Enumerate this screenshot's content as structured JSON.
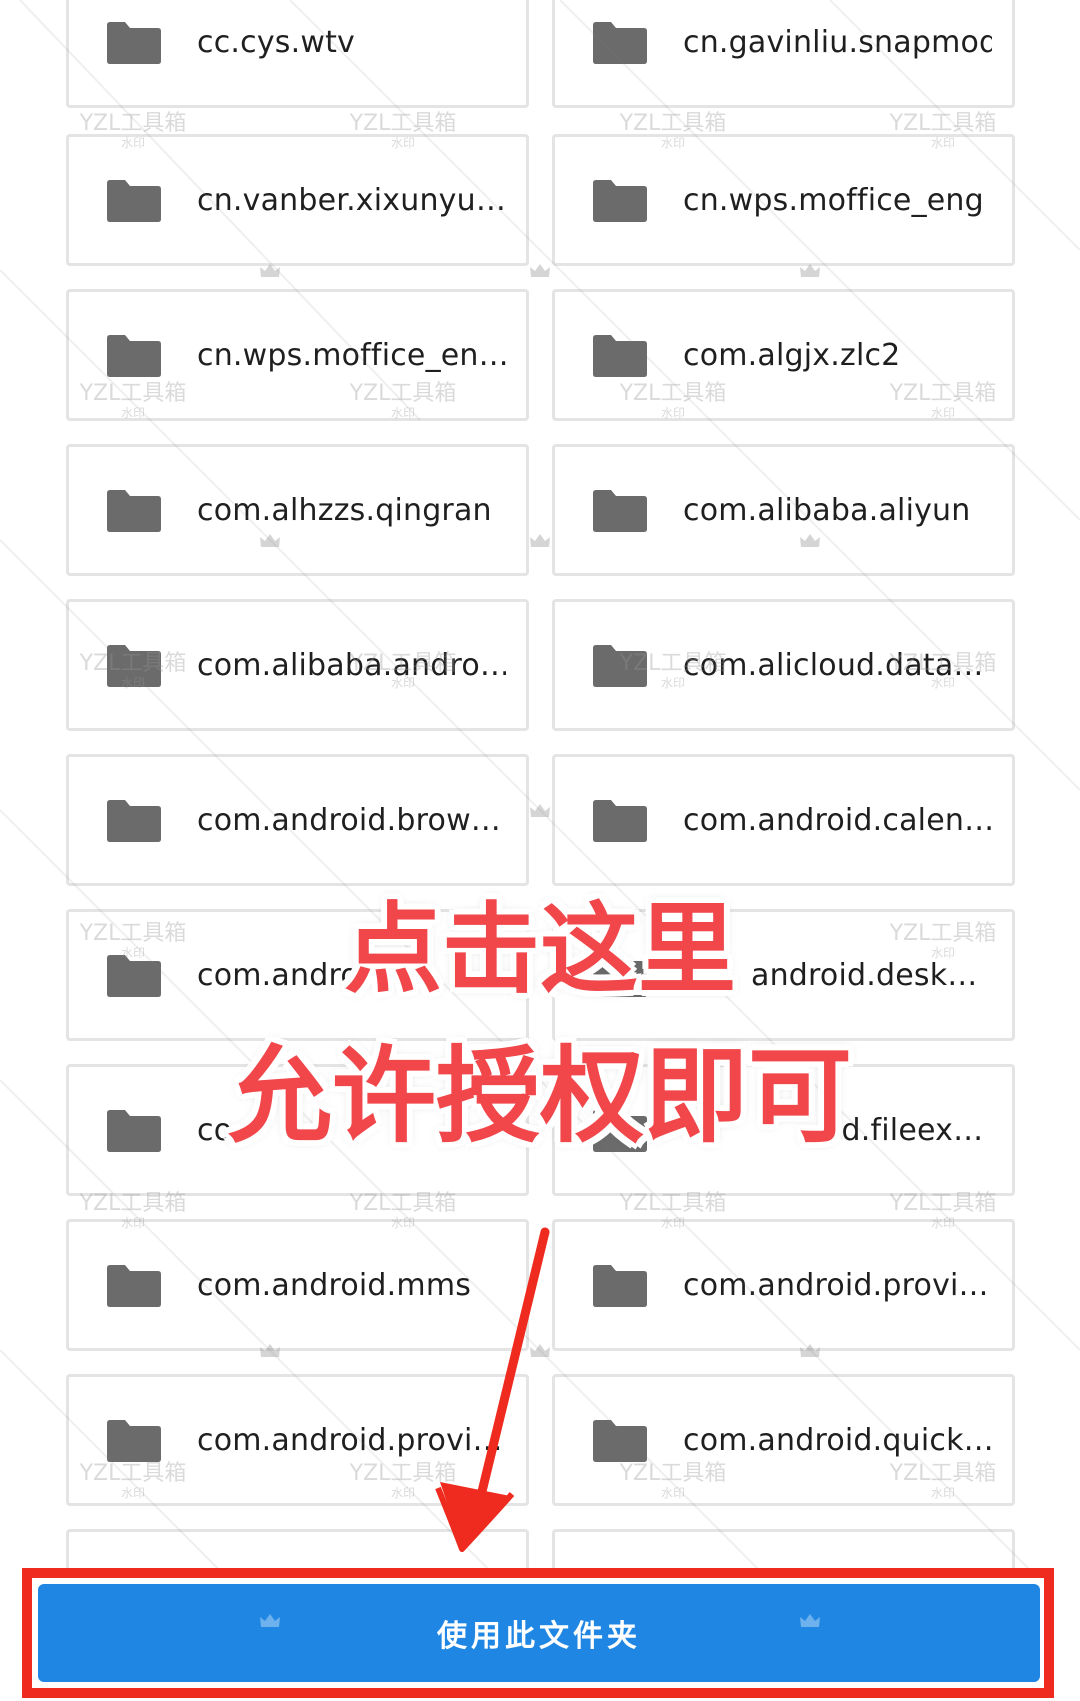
{
  "folders": [
    {
      "name": "cc.cys.wtv"
    },
    {
      "name": "cn.gavinliu.snapmod"
    },
    {
      "name": "cn.vanber.xixunyu…"
    },
    {
      "name": "cn.wps.moffice_eng"
    },
    {
      "name": "cn.wps.moffice_en…"
    },
    {
      "name": "com.algjx.zlc2"
    },
    {
      "name": "com.alhzzs.qingran"
    },
    {
      "name": "com.alibaba.aliyun"
    },
    {
      "name": "com.alibaba.andro…"
    },
    {
      "name": "com.alicloud.data…"
    },
    {
      "name": "com.android.brow…"
    },
    {
      "name": "com.android.calen…"
    },
    {
      "name": "com.andro"
    },
    {
      "name": "android.desk…"
    },
    {
      "name": "co"
    },
    {
      "name": "id.fileex…"
    },
    {
      "name": "com.android.mms"
    },
    {
      "name": "com.android.provi…"
    },
    {
      "name": "com.android.provi…"
    },
    {
      "name": "com.android.quick…"
    }
  ],
  "icons": {
    "folder": "folder-icon",
    "crown": "crown-icon"
  },
  "watermark": {
    "main": "YZL工具箱",
    "sub": "水印"
  },
  "annotation": {
    "line1": "点击这里",
    "line2": "允许授权即可",
    "color": "#f1464a"
  },
  "action": {
    "use_folder_label": "使用此文件夹",
    "button_color": "#1f87e3",
    "highlight_color": "#ef2a1e"
  }
}
